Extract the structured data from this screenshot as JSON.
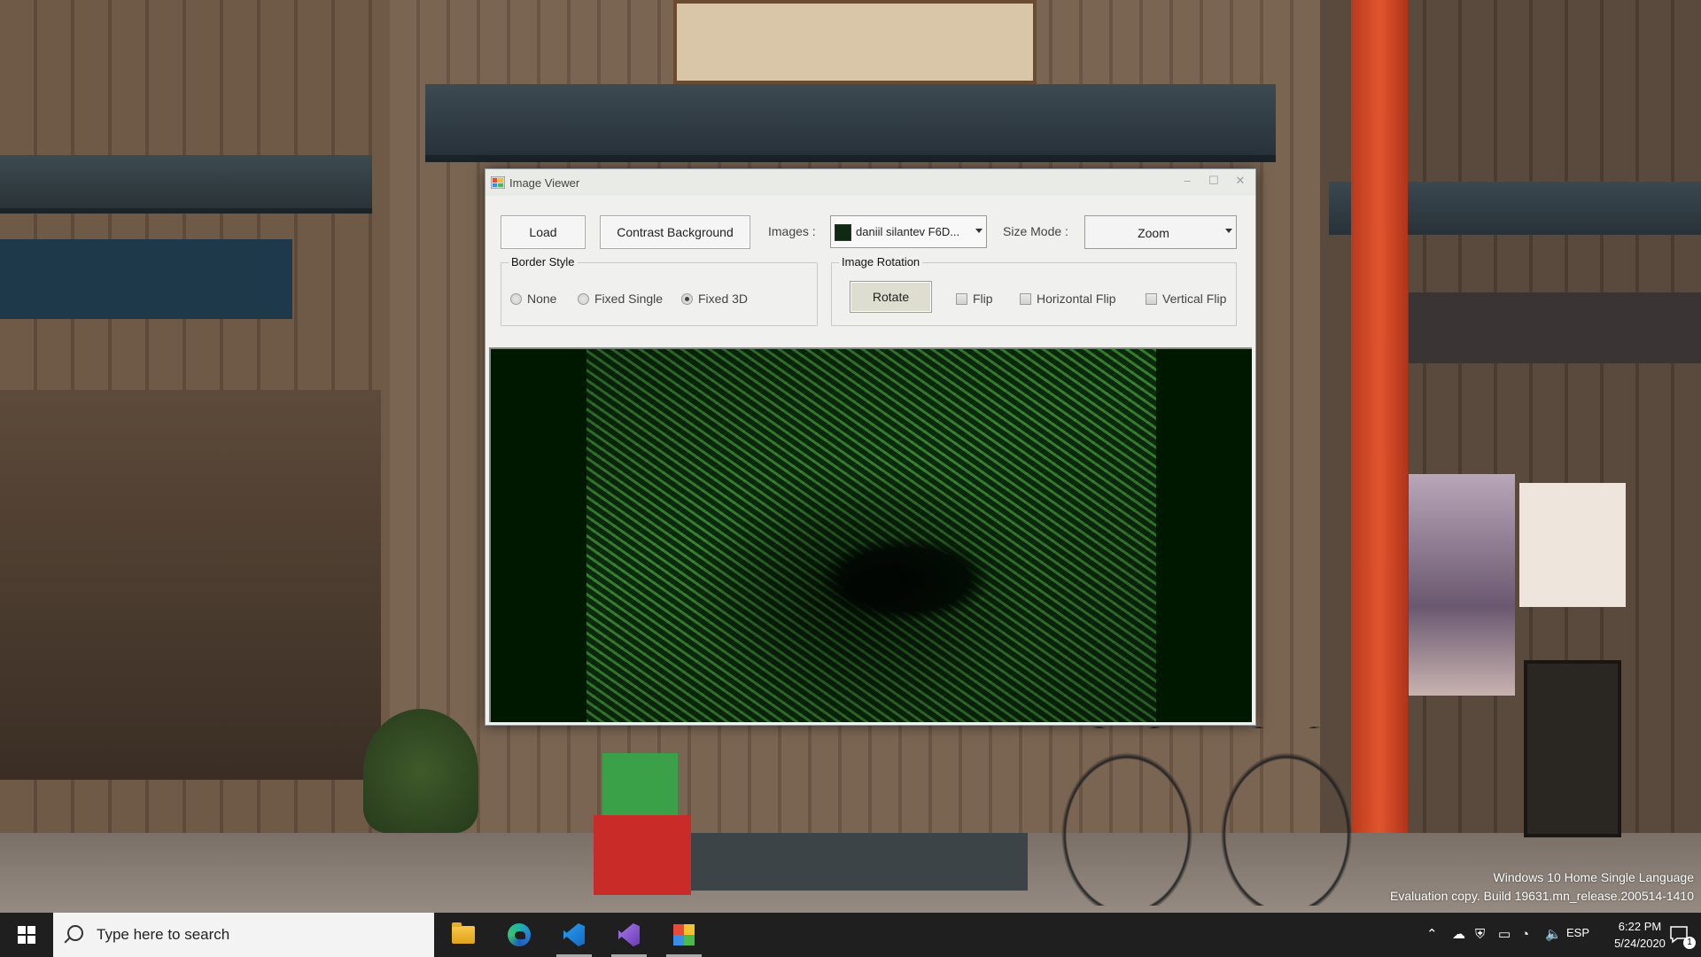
{
  "window": {
    "title": "Image Viewer",
    "controls": {
      "minimize": "–",
      "maximize": "☐",
      "close": "✕"
    }
  },
  "toolbar": {
    "load_label": "Load",
    "contrast_label": "Contrast Background",
    "images_label": "Images :",
    "images_value": "daniil silantev F6D...",
    "size_mode_label": "Size Mode :",
    "size_mode_value": "Zoom"
  },
  "border_style": {
    "title": "Border Style",
    "options": [
      {
        "label": "None",
        "checked": false
      },
      {
        "label": "Fixed Single",
        "checked": false
      },
      {
        "label": "Fixed 3D",
        "checked": true
      }
    ]
  },
  "image_rotation": {
    "title": "Image Rotation",
    "rotate_label": "Rotate",
    "options": [
      {
        "label": "Flip",
        "checked": false
      },
      {
        "label": "Horizontal Flip",
        "checked": false
      },
      {
        "label": "Vertical Flip",
        "checked": false
      }
    ]
  },
  "picture": {
    "background_color": "#001800",
    "image_icon": "fern-photo"
  },
  "watermark": {
    "line1": "Windows 10 Home Single Language",
    "line2": "Evaluation copy. Build 19631.mn_release.200514-1410"
  },
  "taskbar": {
    "search_placeholder": "Type here to search",
    "apps": [
      "file-explorer-icon",
      "edge-icon",
      "vscode-icon",
      "visual-studio-icon",
      "image-viewer-icon"
    ],
    "tray": {
      "language": "ESP",
      "time": "6:22 PM",
      "date": "5/24/2020",
      "notification_count": "1"
    }
  },
  "colors": {
    "taskbar": "#1f1f1f",
    "window_bg": "#f0f0ef",
    "picture_bg": "#001800"
  }
}
